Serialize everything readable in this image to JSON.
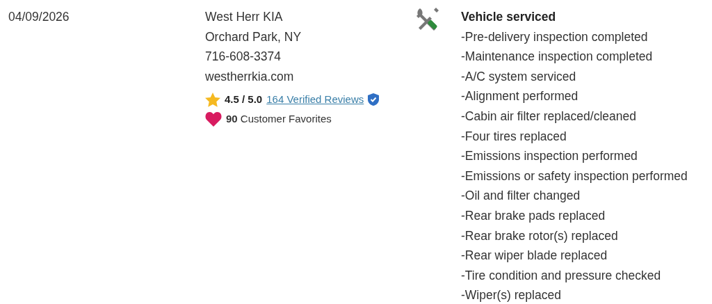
{
  "date": "04/09/2026",
  "dealer": {
    "name": "West Herr KIA",
    "location": "Orchard Park, NY",
    "phone": "716-608-3374",
    "website": "westherrkia.com",
    "rating": "4.5 / 5.0",
    "reviews_link": "164 Verified Reviews",
    "favorites": "**90** Customer Favorites"
  },
  "service": {
    "title": "Vehicle serviced",
    "items": [
      "-Pre-delivery inspection completed",
      "-Maintenance inspection completed",
      "-A/C system serviced",
      "-Alignment performed",
      "-Cabin air filter replaced/cleaned",
      "-Four tires replaced",
      "-Emissions inspection performed",
      "-Emissions or safety inspection performed",
      "-Oil and filter changed",
      "-Rear brake pads replaced",
      "-Rear brake rotor(s) replaced",
      "-Rear wiper blade replaced",
      "-Tire condition and pressure checked",
      "-Wiper(s) replaced"
    ]
  }
}
